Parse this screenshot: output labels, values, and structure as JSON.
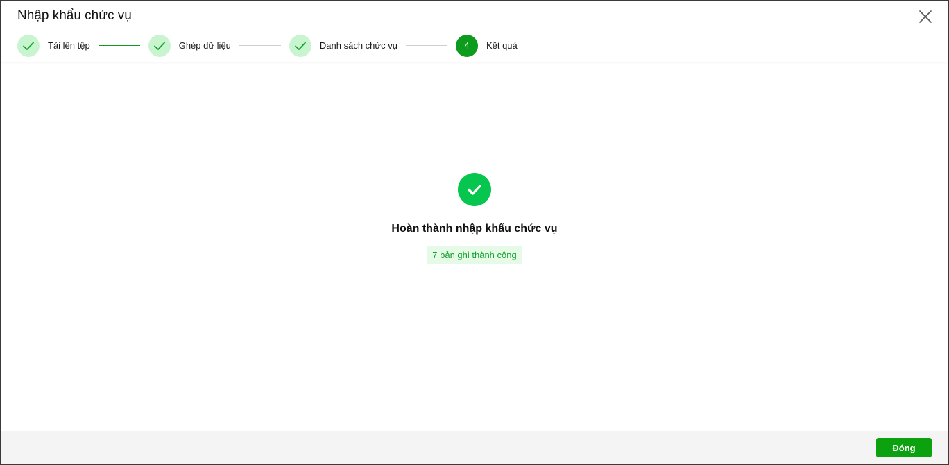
{
  "dialog": {
    "title": "Nhập khẩu chức vụ"
  },
  "steps": [
    {
      "label": "Tải lên tệp",
      "status": "done"
    },
    {
      "label": "Ghép dữ liệu",
      "status": "done"
    },
    {
      "label": "Danh sách chức vụ",
      "status": "done"
    },
    {
      "label": "Kết quả",
      "status": "active",
      "number": "4"
    }
  ],
  "result": {
    "title": "Hoàn thành nhập khẩu chức vụ",
    "badge": "7 bản ghi thành công"
  },
  "footer": {
    "close_label": "Đóng"
  },
  "colors": {
    "primary": "#0ca10f",
    "success_icon": "#07c64f",
    "step_done_bg": "#c8f5cf",
    "badge_bg": "#e5fbe8",
    "badge_text": "#15a12a"
  }
}
